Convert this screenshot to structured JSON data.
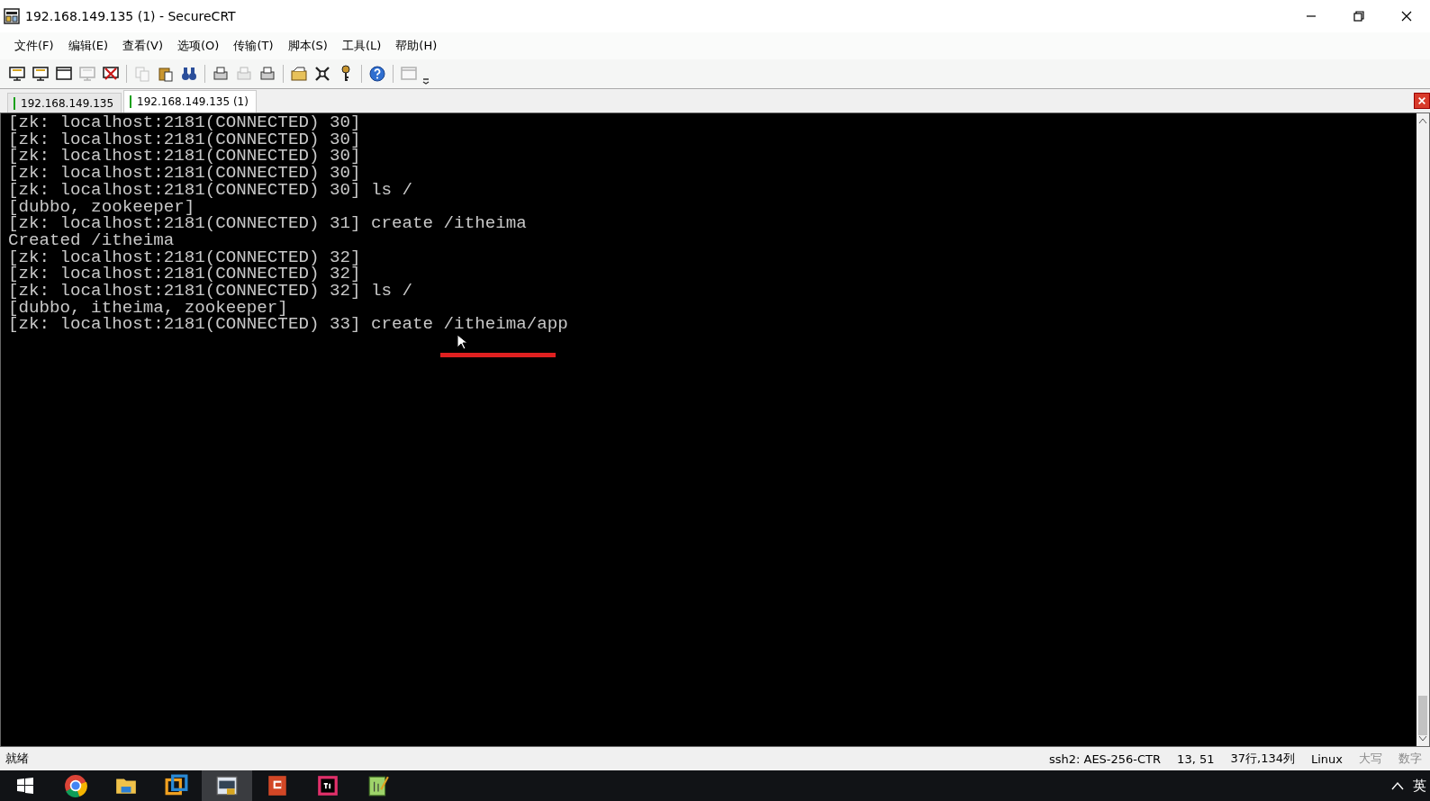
{
  "window": {
    "title": "192.168.149.135 (1) - SecureCRT"
  },
  "menu": [
    "文件(F)",
    "编辑(E)",
    "查看(V)",
    "选项(O)",
    "传输(T)",
    "脚本(S)",
    "工具(L)",
    "帮助(H)"
  ],
  "toolbar": [
    {
      "kind": "connect",
      "disabled": false
    },
    {
      "kind": "connect",
      "disabled": false
    },
    {
      "kind": "window",
      "disabled": false
    },
    {
      "kind": "connect",
      "disabled": true
    },
    {
      "kind": "disconnect",
      "disabled": false
    },
    {
      "kind": "separator"
    },
    {
      "kind": "copy",
      "disabled": true
    },
    {
      "kind": "paste",
      "disabled": false
    },
    {
      "kind": "find",
      "disabled": false
    },
    {
      "kind": "separator"
    },
    {
      "kind": "print",
      "disabled": false
    },
    {
      "kind": "print",
      "disabled": true
    },
    {
      "kind": "print",
      "disabled": false
    },
    {
      "kind": "separator"
    },
    {
      "kind": "settings",
      "disabled": false
    },
    {
      "kind": "tools",
      "disabled": false
    },
    {
      "kind": "key",
      "disabled": false
    },
    {
      "kind": "separator"
    },
    {
      "kind": "help",
      "disabled": false
    },
    {
      "kind": "separator"
    },
    {
      "kind": "window",
      "disabled": true
    }
  ],
  "tabs": [
    {
      "label": "192.168.149.135",
      "selected": false,
      "connected": true
    },
    {
      "label": "192.168.149.135 (1)",
      "selected": true,
      "connected": true
    }
  ],
  "terminal": {
    "lines": [
      "[zk: localhost:2181(CONNECTED) 30]",
      "[zk: localhost:2181(CONNECTED) 30]",
      "[zk: localhost:2181(CONNECTED) 30]",
      "[zk: localhost:2181(CONNECTED) 30]",
      "[zk: localhost:2181(CONNECTED) 30] ls /",
      "[dubbo, zookeeper]",
      "[zk: localhost:2181(CONNECTED) 31] create /itheima",
      "Created /itheima",
      "[zk: localhost:2181(CONNECTED) 32]",
      "[zk: localhost:2181(CONNECTED) 32]",
      "[zk: localhost:2181(CONNECTED) 32] ls /",
      "[dubbo, itheima, zookeeper]",
      "[zk: localhost:2181(CONNECTED) 33] create /itheima/app"
    ]
  },
  "status_bar": [
    {
      "text": "就绪",
      "disabled": false
    },
    {
      "text": "ssh2: AES-256-CTR",
      "disabled": false
    },
    {
      "text": "13,  51",
      "disabled": false
    },
    {
      "text": "37行,134列",
      "disabled": false
    },
    {
      "text": "Linux",
      "disabled": false
    },
    {
      "text": "大写",
      "disabled": true
    },
    {
      "text": "数字",
      "disabled": true
    }
  ],
  "taskbar": {
    "apps": [
      {
        "kind": "browser",
        "selected": false
      },
      {
        "kind": "folder",
        "selected": false
      },
      {
        "kind": "vm",
        "selected": false
      },
      {
        "kind": "terminal",
        "selected": true
      },
      {
        "kind": "slides",
        "selected": false
      },
      {
        "kind": "ide",
        "selected": false
      },
      {
        "kind": "notepad",
        "selected": false
      }
    ],
    "input_method": "英"
  }
}
